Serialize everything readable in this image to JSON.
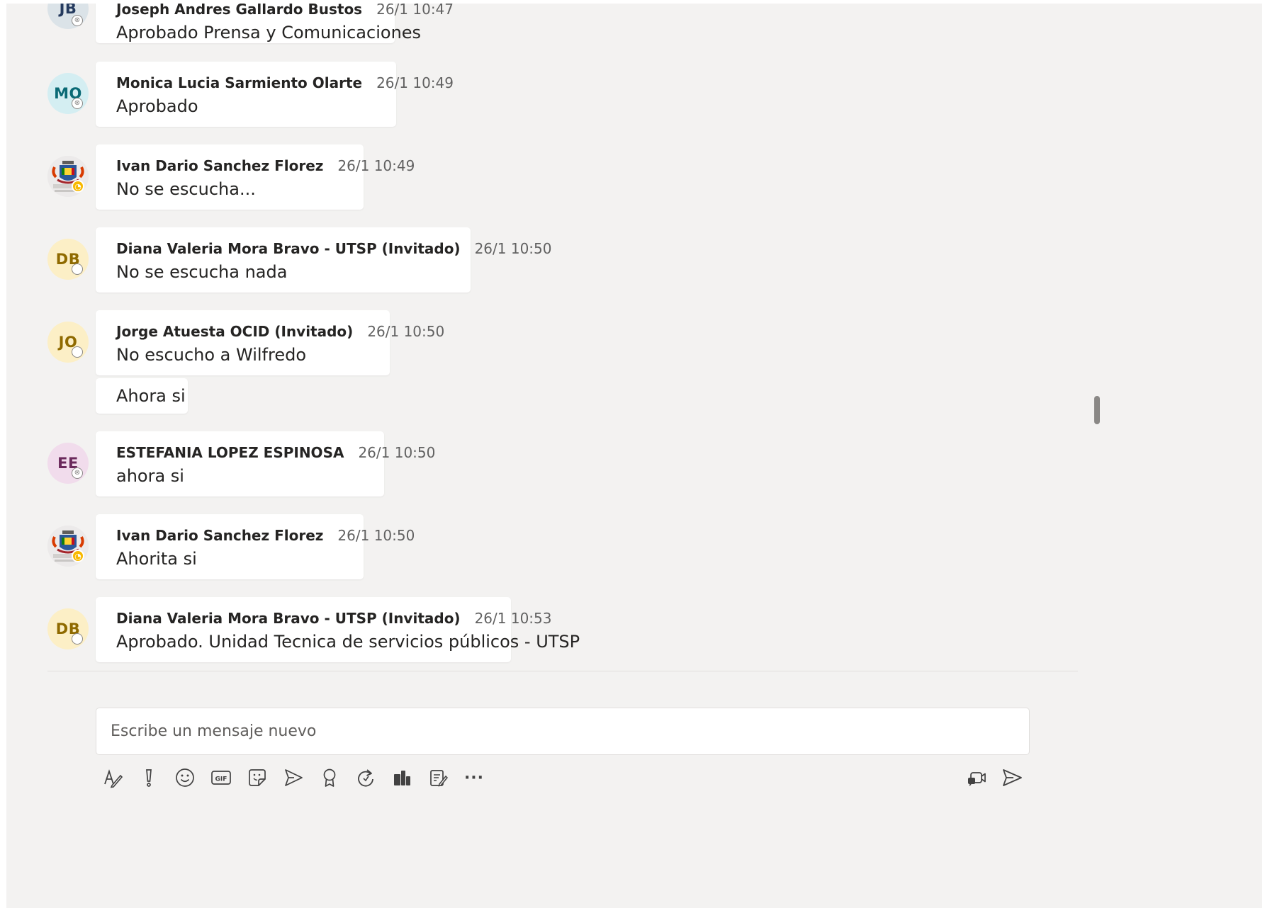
{
  "colors": {
    "panel_bg": "#f3f2f1",
    "bubble_bg": "#ffffff",
    "away_status": "#f8b900"
  },
  "messages": [
    {
      "avatar_initials": "JB",
      "avatar_bg": "#dbe3e8",
      "avatar_fg": "#243a5e",
      "status": "offline",
      "sender": "Joseph Andres Gallardo Bustos",
      "time": "26/1 10:47",
      "text": "Aprobado Prensa y Comunicaciones"
    },
    {
      "avatar_initials": "MO",
      "avatar_bg": "#d4eef2",
      "avatar_fg": "#0b6a75",
      "status": "offline",
      "sender": "Monica Lucia Sarmiento Olarte",
      "time": "26/1 10:49",
      "text": "Aprobado"
    },
    {
      "avatar_icon": "municipal-crest-icon",
      "status": "away",
      "sender": "Ivan Dario Sanchez Florez",
      "time": "26/1 10:49",
      "text": "No se escucha..."
    },
    {
      "avatar_initials": "DB",
      "avatar_bg": "#fcefc6",
      "avatar_fg": "#8f6a00",
      "status": "unknown",
      "sender": "Diana Valeria Mora Bravo - UTSP (Invitado)",
      "time": "26/1 10:50",
      "text": "No se escucha nada"
    },
    {
      "avatar_initials": "JO",
      "avatar_bg": "#fcefc6",
      "avatar_fg": "#8f6a00",
      "status": "unknown",
      "sender": "Jorge Atuesta OCID (Invitado)",
      "time": "26/1 10:50",
      "text": "No escucho a Wilfredo",
      "followup": "Ahora si"
    },
    {
      "avatar_initials": "EE",
      "avatar_bg": "#f1dcec",
      "avatar_fg": "#6b2a5c",
      "status": "offline",
      "sender": "ESTEFANIA LOPEZ ESPINOSA",
      "time": "26/1 10:50",
      "text": "ahora si"
    },
    {
      "avatar_icon": "municipal-crest-icon",
      "status": "away",
      "sender": "Ivan Dario Sanchez Florez",
      "time": "26/1 10:50",
      "text": "Ahorita si"
    },
    {
      "avatar_initials": "DB",
      "avatar_bg": "#fcefc6",
      "avatar_fg": "#8f6a00",
      "status": "unknown",
      "sender": "Diana Valeria Mora Bravo - UTSP (Invitado)",
      "time": "26/1 10:53",
      "text": "Aprobado. Unidad Tecnica de servicios públicos - UTSP"
    }
  ],
  "compose": {
    "placeholder": "Escribe un mensaje nuevo"
  },
  "toolbar": {
    "left_icons": [
      "format-icon",
      "important-icon",
      "emoji-icon",
      "gif-icon",
      "sticker-icon",
      "meet-now-icon",
      "praise-icon",
      "loop-icon",
      "stream-icon",
      "forms-icon",
      "more-options-icon"
    ],
    "right_icons": [
      "video-message-icon",
      "send-icon"
    ],
    "gif_label": "GIF",
    "more_label": "···"
  }
}
